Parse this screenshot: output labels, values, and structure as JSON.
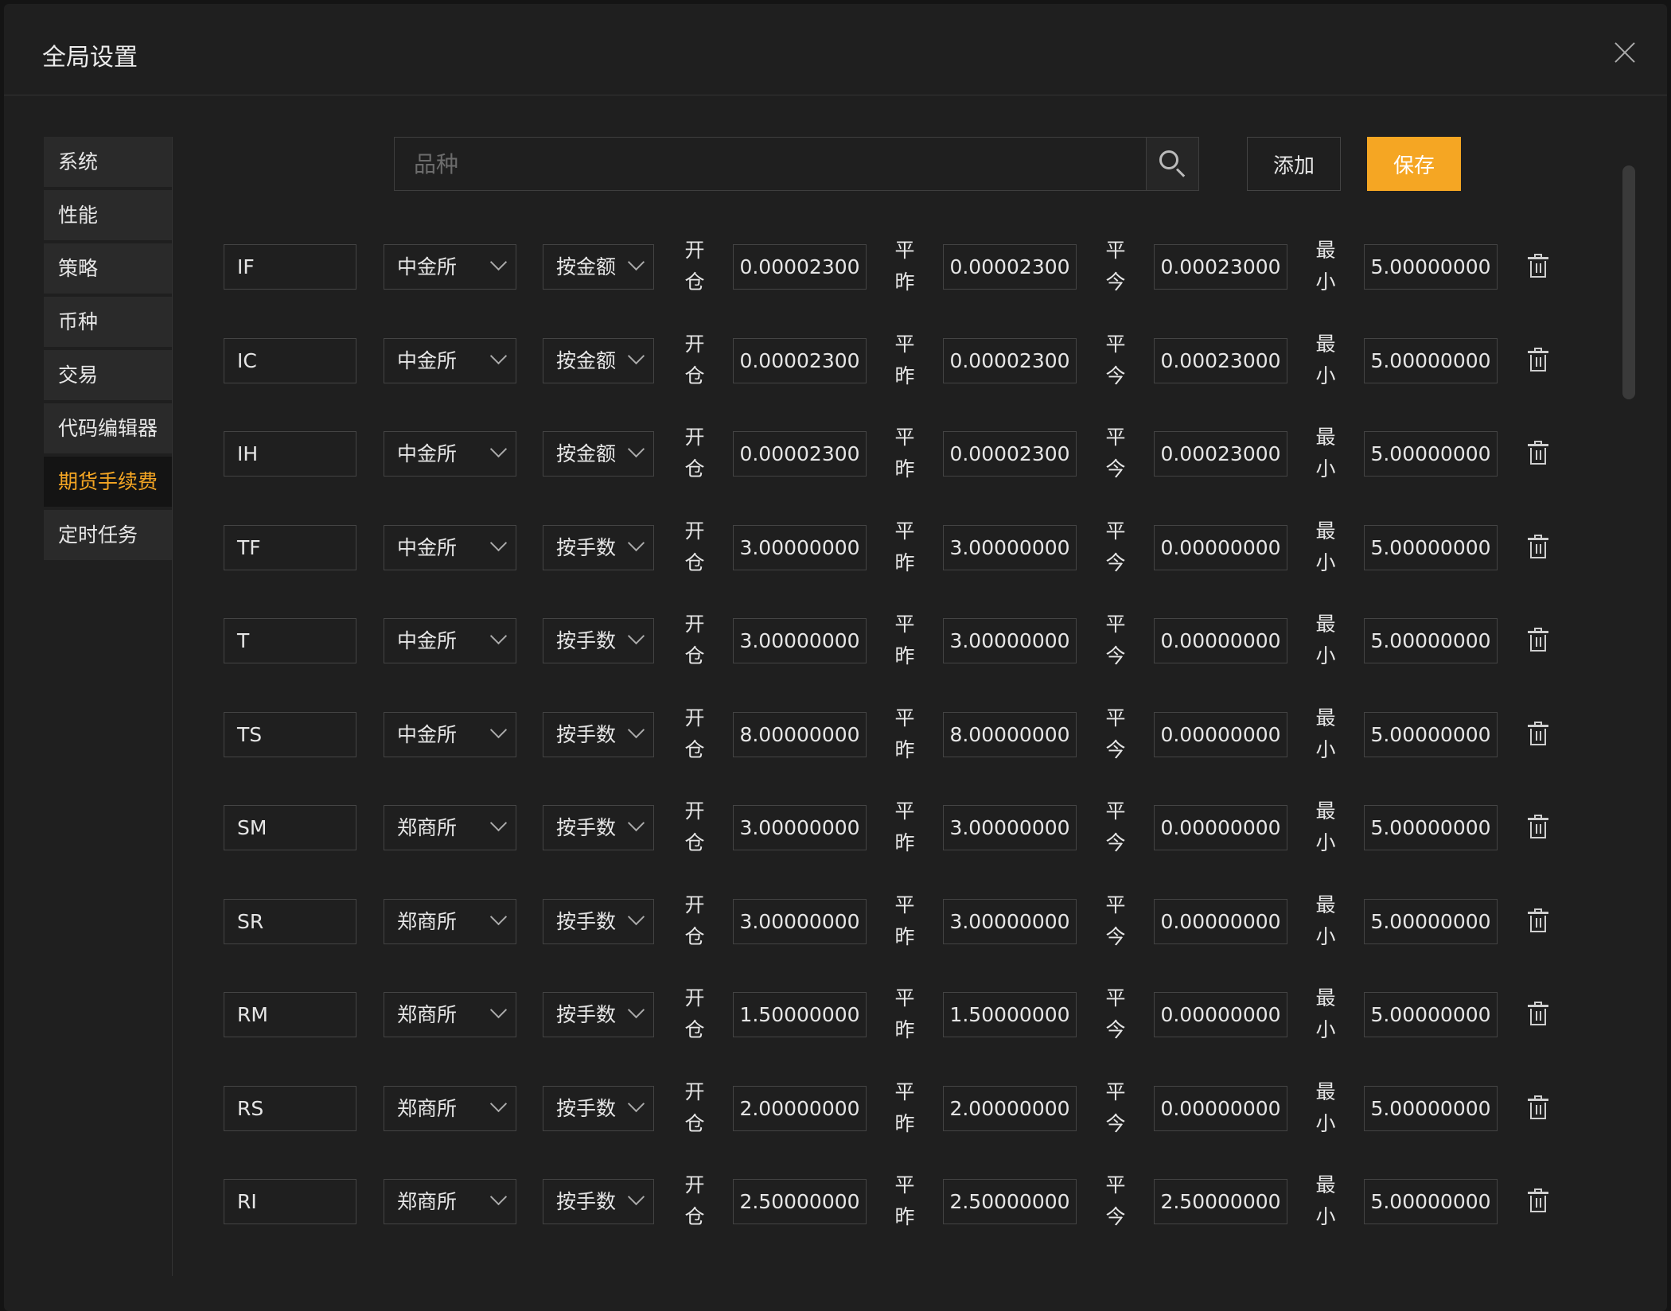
{
  "dialog": {
    "title": "全局设置"
  },
  "sidebar": {
    "items": [
      {
        "label": "系统",
        "active": false
      },
      {
        "label": "性能",
        "active": false
      },
      {
        "label": "策略",
        "active": false
      },
      {
        "label": "币种",
        "active": false
      },
      {
        "label": "交易",
        "active": false
      },
      {
        "label": "代码编辑器",
        "active": false
      },
      {
        "label": "期货手续费",
        "active": true
      },
      {
        "label": "定时任务",
        "active": false
      }
    ]
  },
  "toolbar": {
    "search_placeholder": "品种",
    "search_value": "",
    "add_label": "添加",
    "save_label": "保存"
  },
  "labels": {
    "open": [
      "开",
      "仓"
    ],
    "close_yesterday": [
      "平",
      "昨"
    ],
    "close_today": [
      "平",
      "今"
    ],
    "minimum": [
      "最",
      "小"
    ]
  },
  "fee_rows": [
    {
      "code": "IF",
      "exchange": "中金所",
      "mode": "按金额",
      "open": "0.00002300",
      "close_yesterday": "0.00002300",
      "close_today": "0.00023000",
      "minimum": "5.00000000"
    },
    {
      "code": "IC",
      "exchange": "中金所",
      "mode": "按金额",
      "open": "0.00002300",
      "close_yesterday": "0.00002300",
      "close_today": "0.00023000",
      "minimum": "5.00000000"
    },
    {
      "code": "IH",
      "exchange": "中金所",
      "mode": "按金额",
      "open": "0.00002300",
      "close_yesterday": "0.00002300",
      "close_today": "0.00023000",
      "minimum": "5.00000000"
    },
    {
      "code": "TF",
      "exchange": "中金所",
      "mode": "按手数",
      "open": "3.00000000",
      "close_yesterday": "3.00000000",
      "close_today": "0.00000000",
      "minimum": "5.00000000"
    },
    {
      "code": "T",
      "exchange": "中金所",
      "mode": "按手数",
      "open": "3.00000000",
      "close_yesterday": "3.00000000",
      "close_today": "0.00000000",
      "minimum": "5.00000000"
    },
    {
      "code": "TS",
      "exchange": "中金所",
      "mode": "按手数",
      "open": "8.00000000",
      "close_yesterday": "8.00000000",
      "close_today": "0.00000000",
      "minimum": "5.00000000"
    },
    {
      "code": "SM",
      "exchange": "郑商所",
      "mode": "按手数",
      "open": "3.00000000",
      "close_yesterday": "3.00000000",
      "close_today": "0.00000000",
      "minimum": "5.00000000"
    },
    {
      "code": "SR",
      "exchange": "郑商所",
      "mode": "按手数",
      "open": "3.00000000",
      "close_yesterday": "3.00000000",
      "close_today": "0.00000000",
      "minimum": "5.00000000"
    },
    {
      "code": "RM",
      "exchange": "郑商所",
      "mode": "按手数",
      "open": "1.50000000",
      "close_yesterday": "1.50000000",
      "close_today": "0.00000000",
      "minimum": "5.00000000"
    },
    {
      "code": "RS",
      "exchange": "郑商所",
      "mode": "按手数",
      "open": "2.00000000",
      "close_yesterday": "2.00000000",
      "close_today": "0.00000000",
      "minimum": "5.00000000"
    },
    {
      "code": "RI",
      "exchange": "郑商所",
      "mode": "按手数",
      "open": "2.50000000",
      "close_yesterday": "2.50000000",
      "close_today": "2.50000000",
      "minimum": "5.00000000"
    }
  ],
  "colors": {
    "accent": "#f5a623",
    "background": "#1f1f1f",
    "text": "#e6e6e6",
    "border": "#444444"
  },
  "icons": {
    "close": "close-icon",
    "search": "search-icon",
    "dropdown": "chevron-down-icon",
    "delete": "trash-icon"
  }
}
